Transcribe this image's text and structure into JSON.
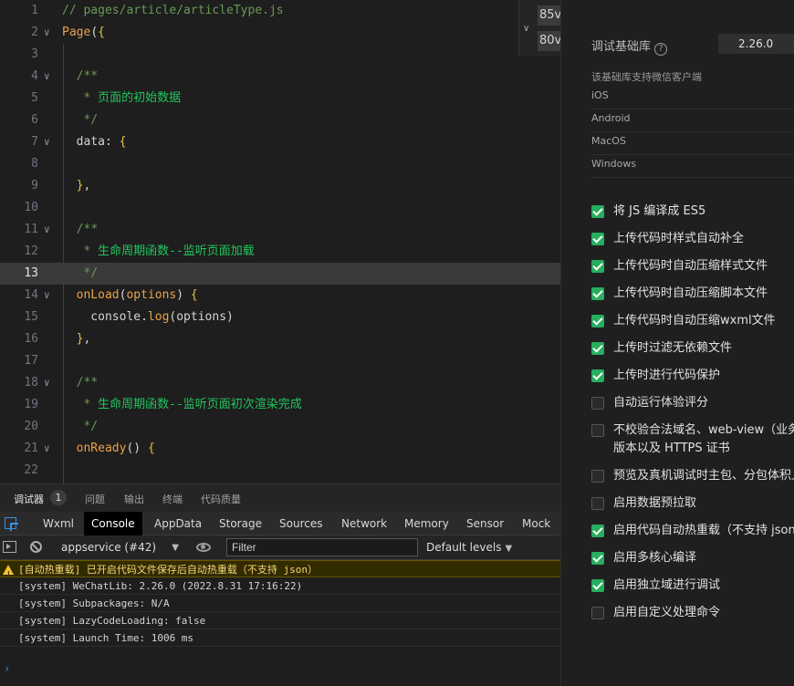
{
  "editor": {
    "lines": [
      {
        "n": "1",
        "segs": [
          [
            "c-comment",
            "// pages/article/articleType.js"
          ]
        ]
      },
      {
        "n": "2",
        "fold": true,
        "segs": [
          [
            "c-fn",
            "Page"
          ],
          [
            "c-var",
            "("
          ],
          [
            "c-brace",
            "{"
          ]
        ]
      },
      {
        "n": "3",
        "segs": []
      },
      {
        "n": "4",
        "fold": true,
        "segs": [
          [
            "c-comment",
            "  /**"
          ]
        ]
      },
      {
        "n": "5",
        "segs": [
          [
            "c-comment",
            "   * "
          ],
          [
            "c-zh",
            "页面的初始数据"
          ]
        ]
      },
      {
        "n": "6",
        "segs": [
          [
            "c-comment",
            "   */"
          ]
        ]
      },
      {
        "n": "7",
        "fold": true,
        "segs": [
          [
            "c-var",
            "  data: "
          ],
          [
            "c-brace",
            "{"
          ]
        ]
      },
      {
        "n": "8",
        "segs": []
      },
      {
        "n": "9",
        "segs": [
          [
            "c-brace",
            "  }"
          ],
          [
            "c-var",
            ","
          ]
        ]
      },
      {
        "n": "10",
        "segs": []
      },
      {
        "n": "11",
        "fold": true,
        "segs": [
          [
            "c-comment",
            "  /**"
          ]
        ]
      },
      {
        "n": "12",
        "segs": [
          [
            "c-comment",
            "   * "
          ],
          [
            "c-zh",
            "生命周期函数--监听页面加载"
          ]
        ]
      },
      {
        "n": "13",
        "active": true,
        "segs": [
          [
            "c-comment",
            "   */"
          ]
        ]
      },
      {
        "n": "14",
        "fold": true,
        "segs": [
          [
            "c-fn",
            "  onLoad"
          ],
          [
            "c-var",
            "("
          ],
          [
            "c-param",
            "options"
          ],
          [
            "c-var",
            ") "
          ],
          [
            "c-brace",
            "{"
          ]
        ]
      },
      {
        "n": "15",
        "segs": [
          [
            "c-var",
            "    console."
          ],
          [
            "c-fn",
            "log"
          ],
          [
            "c-var",
            "(options)"
          ]
        ]
      },
      {
        "n": "16",
        "segs": [
          [
            "c-brace",
            "  }"
          ],
          [
            "c-var",
            ","
          ]
        ]
      },
      {
        "n": "17",
        "segs": []
      },
      {
        "n": "18",
        "fold": true,
        "segs": [
          [
            "c-comment",
            "  /**"
          ]
        ]
      },
      {
        "n": "19",
        "segs": [
          [
            "c-comment",
            "   * "
          ],
          [
            "c-zh",
            "生命周期函数--监听页面初次渲染完成"
          ]
        ]
      },
      {
        "n": "20",
        "segs": [
          [
            "c-comment",
            "   */"
          ]
        ]
      },
      {
        "n": "21",
        "fold": true,
        "segs": [
          [
            "c-fn",
            "  onReady"
          ],
          [
            "c-var",
            "() "
          ],
          [
            "c-brace",
            "{"
          ]
        ]
      },
      {
        "n": "22",
        "segs": []
      }
    ],
    "suggestions": [
      "85v",
      "80v"
    ]
  },
  "panel": {
    "lib_label": "调试基础库",
    "help_icon": "?",
    "lib_version": "2.26.0",
    "lib_more": "0",
    "support_text": "该基础库支持微信客户端",
    "platforms": [
      "iOS",
      "Android",
      "MacOS",
      "Windows"
    ],
    "options": [
      {
        "label": "将 JS 编译成 ES5",
        "checked": true
      },
      {
        "label": "上传代码时样式自动补全",
        "checked": true
      },
      {
        "label": "上传代码时自动压缩样式文件",
        "checked": true
      },
      {
        "label": "上传代码时自动压缩脚本文件",
        "checked": true
      },
      {
        "label": "上传代码时自动压缩wxml文件",
        "checked": true
      },
      {
        "label": "上传时过滤无依赖文件",
        "checked": true
      },
      {
        "label": "上传时进行代码保护",
        "checked": true
      },
      {
        "label": "自动运行体验评分",
        "checked": false
      },
      {
        "label": "不校验合法域名、web-view（业务\n版本以及 HTTPS 证书",
        "checked": false
      },
      {
        "label": "预览及真机调试时主包、分包体积上",
        "checked": false
      },
      {
        "label": "启用数据预拉取",
        "checked": false
      },
      {
        "label": "启用代码自动热重载（不支持 json",
        "checked": true
      },
      {
        "label": "启用多核心编译",
        "checked": true
      },
      {
        "label": "启用独立域进行调试",
        "checked": true
      },
      {
        "label": "启用自定义处理命令",
        "checked": false
      }
    ]
  },
  "bottom": {
    "tabs": [
      "调试器",
      "问题",
      "输出",
      "终端",
      "代码质量"
    ],
    "badge": "1",
    "devtools_tabs": [
      "Wxml",
      "Console",
      "AppData",
      "Storage",
      "Sources",
      "Network",
      "Memory",
      "Sensor",
      "Mock"
    ],
    "active_devtools_tab": "Console",
    "context": "appservice (#42)",
    "filter_placeholder": "Filter",
    "levels": "Default levels",
    "logs": [
      {
        "type": "warn",
        "text": "[自动热重载] 已开启代码文件保存后自动热重载（不支持 json）"
      },
      {
        "type": "log",
        "text": "[system] WeChatLib: 2.26.0 (2022.8.31 17:16:22)"
      },
      {
        "type": "log",
        "text": "[system] Subpackages: N/A"
      },
      {
        "type": "log",
        "text": "[system] LazyCodeLoading: false"
      },
      {
        "type": "log",
        "text": "[system] Launch Time: 1006 ms"
      }
    ],
    "prompt": "›"
  }
}
